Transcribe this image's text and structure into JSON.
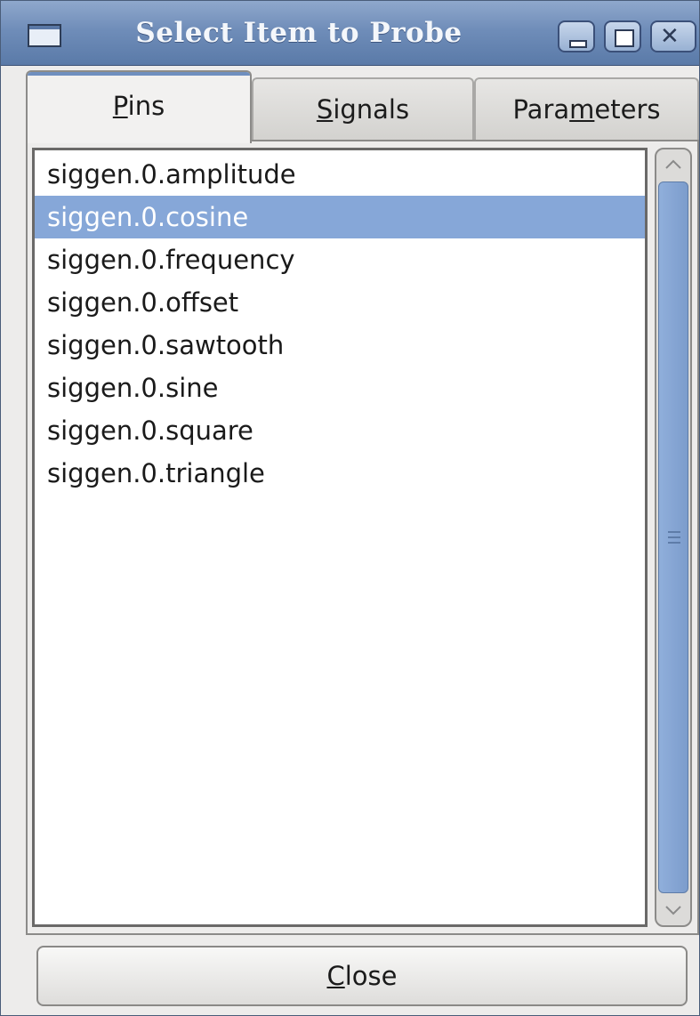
{
  "window": {
    "title": "Select Item to Probe"
  },
  "titlebar_buttons": {
    "minimize_icon": "minimize-icon",
    "maximize_icon": "maximize-icon",
    "close_icon": "close-icon"
  },
  "tabs": [
    {
      "label_mnemonic": "P",
      "label_rest": "ins",
      "active": true
    },
    {
      "label_mnemonic": "S",
      "label_rest": "ignals",
      "active": false
    },
    {
      "label_pre": "Para",
      "label_mnemonic": "m",
      "label_rest": "eters",
      "active": false
    }
  ],
  "list": {
    "items": [
      "siggen.0.amplitude",
      "siggen.0.cosine",
      "siggen.0.frequency",
      "siggen.0.offset",
      "siggen.0.sawtooth",
      "siggen.0.sine",
      "siggen.0.square",
      "siggen.0.triangle"
    ],
    "selected_index": 1
  },
  "scrollbar": {
    "up_icon": "scroll-up-arrow-icon",
    "down_icon": "scroll-down-arrow-icon"
  },
  "close_button": {
    "label_mnemonic": "C",
    "label_rest": "lose"
  },
  "colors": {
    "titlebar": "#6f8db9",
    "selection": "#86a7d8"
  }
}
